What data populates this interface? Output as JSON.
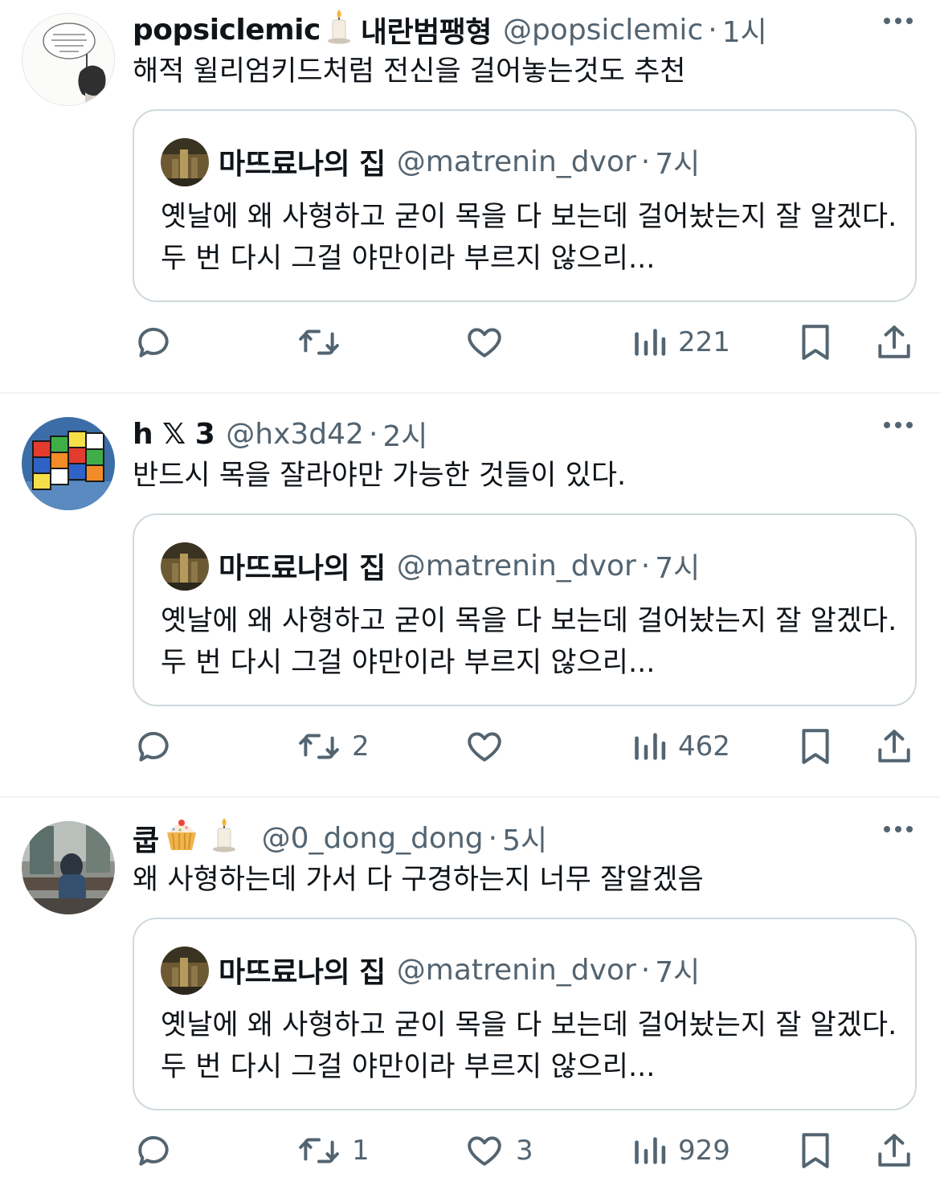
{
  "tweets": [
    {
      "name": "popsiclemic",
      "name_suffix": "내란범팽형",
      "handle": "@popsiclemic",
      "time": "1시",
      "text": "해적 윌리엄키드처럼 전신을 걸어놓는것도 추천",
      "quote": {
        "name": "마뜨료나의 집",
        "handle": "@matrenin_dvor",
        "time": "7시",
        "text": "옛날에 왜 사형하고 굳이 목을 다 보는데 걸어놨는지 잘 알겠다. 두 번 다시 그걸 야만이라 부르지 않으리..."
      },
      "replies": "",
      "retweets": "",
      "likes": "",
      "views": "221"
    },
    {
      "name": "h 𝕏 3",
      "name_suffix": "",
      "handle": "@hx3d42",
      "time": "2시",
      "text": "반드시 목을 잘라야만 가능한 것들이 있다.",
      "quote": {
        "name": "마뜨료나의 집",
        "handle": "@matrenin_dvor",
        "time": "7시",
        "text": "옛날에 왜 사형하고 굳이 목을 다 보는데 걸어놨는지 잘 알겠다. 두 번 다시 그걸 야만이라 부르지 않으리..."
      },
      "replies": "",
      "retweets": "2",
      "likes": "",
      "views": "462"
    },
    {
      "name": "쿱",
      "name_suffix": "",
      "handle": "@0_dong_dong",
      "time": "5시",
      "text": "왜 사형하는데 가서 다 구경하는지 너무 잘알겠음",
      "quote": {
        "name": "마뜨료나의 집",
        "handle": "@matrenin_dvor",
        "time": "7시",
        "text": "옛날에 왜 사형하고 굳이 목을 다 보는데 걸어놨는지 잘 알겠다. 두 번 다시 그걸 야만이라 부르지 않으리..."
      },
      "replies": "",
      "retweets": "1",
      "likes": "3",
      "views": "929"
    }
  ],
  "separator": "·",
  "icons": [
    "reply-icon",
    "retweet-icon",
    "like-icon",
    "views-icon",
    "bookmark-icon",
    "share-icon",
    "more-icon",
    "candle-emoji-icon",
    "cupcake-emoji-icon"
  ],
  "colors": {
    "text": "#0f1419",
    "secondary": "#536471",
    "border": "#cfd9de",
    "divider": "#eff3f4"
  }
}
